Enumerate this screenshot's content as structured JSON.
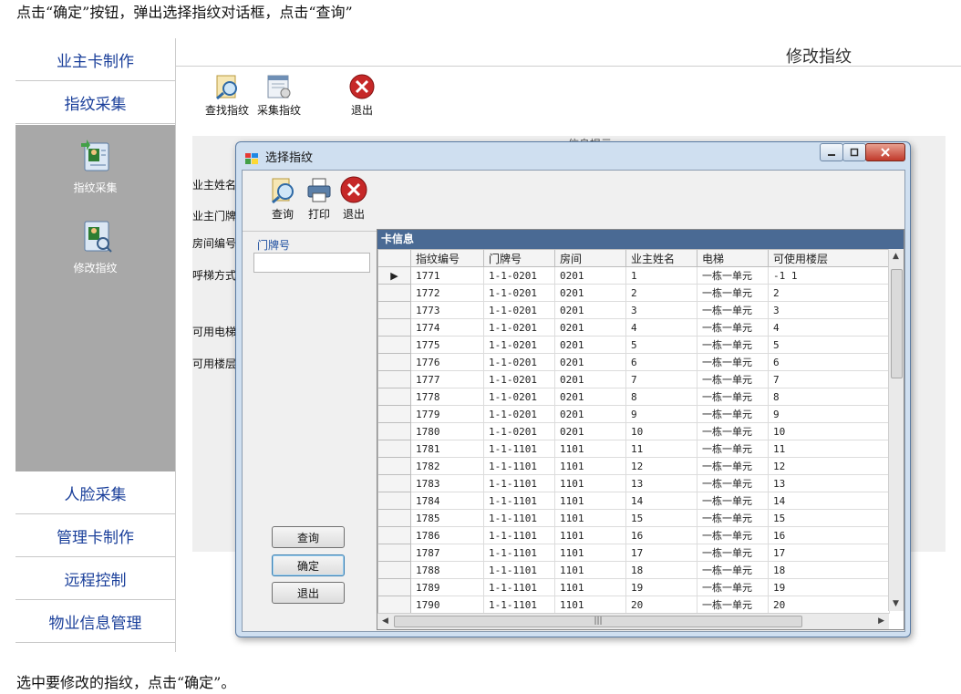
{
  "captions": {
    "top": "点击“确定”按钮，弹出选择指纹对话框，点击“查询”",
    "bottom": "选中要修改的指纹，点击“确定”。"
  },
  "nav": {
    "items_top": [
      "业主卡制作",
      "指纹采集"
    ],
    "panel_tools": [
      "指纹采集",
      "修改指纹"
    ],
    "items_bottom": [
      "人脸采集",
      "管理卡制作",
      "远程控制",
      "物业信息管理"
    ]
  },
  "main": {
    "title": "修改指纹",
    "toolbar": [
      "查找指纹",
      "采集指纹",
      "退出"
    ],
    "info_tip": "信息提示",
    "form_labels": [
      "业主姓名",
      "业主门牌",
      "房间编号",
      "呼梯方式",
      "可用电梯",
      "可用楼层"
    ]
  },
  "dialog": {
    "title": "选择指纹",
    "toolbar": [
      "查询",
      "打印",
      "退出"
    ],
    "door_label": "门牌号",
    "door_value": "",
    "buttons": [
      "查询",
      "确定",
      "退出"
    ],
    "grid_title": "卡信息",
    "columns": [
      "指纹编号",
      "门牌号",
      "房间",
      "业主姓名",
      "电梯",
      "可使用楼层"
    ],
    "rows": [
      [
        "1771",
        "1-1-0201",
        "0201",
        "1",
        "一栋一单元",
        "-1 1"
      ],
      [
        "1772",
        "1-1-0201",
        "0201",
        "2",
        "一栋一单元",
        "2"
      ],
      [
        "1773",
        "1-1-0201",
        "0201",
        "3",
        "一栋一单元",
        "3"
      ],
      [
        "1774",
        "1-1-0201",
        "0201",
        "4",
        "一栋一单元",
        "4"
      ],
      [
        "1775",
        "1-1-0201",
        "0201",
        "5",
        "一栋一单元",
        "5"
      ],
      [
        "1776",
        "1-1-0201",
        "0201",
        "6",
        "一栋一单元",
        "6"
      ],
      [
        "1777",
        "1-1-0201",
        "0201",
        "7",
        "一栋一单元",
        "7"
      ],
      [
        "1778",
        "1-1-0201",
        "0201",
        "8",
        "一栋一单元",
        "8"
      ],
      [
        "1779",
        "1-1-0201",
        "0201",
        "9",
        "一栋一单元",
        "9"
      ],
      [
        "1780",
        "1-1-0201",
        "0201",
        "10",
        "一栋一单元",
        "10"
      ],
      [
        "1781",
        "1-1-1101",
        "1101",
        "11",
        "一栋一单元",
        "11"
      ],
      [
        "1782",
        "1-1-1101",
        "1101",
        "12",
        "一栋一单元",
        "12"
      ],
      [
        "1783",
        "1-1-1101",
        "1101",
        "13",
        "一栋一单元",
        "13"
      ],
      [
        "1784",
        "1-1-1101",
        "1101",
        "14",
        "一栋一单元",
        "14"
      ],
      [
        "1785",
        "1-1-1101",
        "1101",
        "15",
        "一栋一单元",
        "15"
      ],
      [
        "1786",
        "1-1-1101",
        "1101",
        "16",
        "一栋一单元",
        "16"
      ],
      [
        "1787",
        "1-1-1101",
        "1101",
        "17",
        "一栋一单元",
        "17"
      ],
      [
        "1788",
        "1-1-1101",
        "1101",
        "18",
        "一栋一单元",
        "18"
      ],
      [
        "1789",
        "1-1-1101",
        "1101",
        "19",
        "一栋一单元",
        "19"
      ],
      [
        "1790",
        "1-1-1101",
        "1101",
        "20",
        "一栋一单元",
        "20"
      ]
    ],
    "selected_row": 0,
    "selected_marker": "▶"
  },
  "colors": {
    "accent": "#1a3f9a",
    "grid_header": "#4a6a94",
    "panel": "#a8a8a8"
  }
}
